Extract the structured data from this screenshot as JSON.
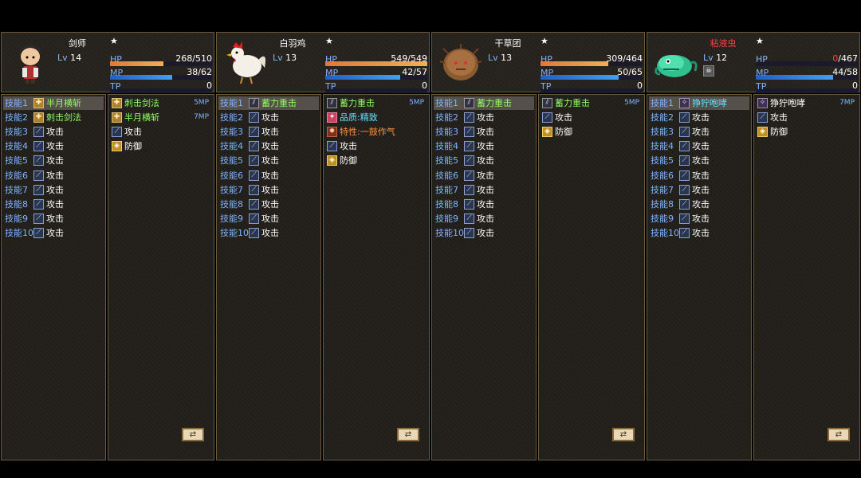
{
  "status_labels": {
    "hp": "HP",
    "mp": "MP",
    "tp": "TP"
  },
  "members": [
    {
      "name": "剑师",
      "name_color": "white",
      "level_label": "Lv",
      "level": "14",
      "star": "★",
      "hp_text": "268/510",
      "hp_ratio": 0.525,
      "mp_text": "38/62",
      "mp_ratio": 0.613,
      "tp_text": "0",
      "tp_ratio": 0,
      "slots": [
        {
          "label": "技能1",
          "skill": "半月横斩",
          "icon": "sword",
          "color": "green"
        },
        {
          "label": "技能2",
          "skill": "刺击剑法",
          "icon": "sword",
          "color": "green"
        },
        {
          "label": "技能3",
          "skill": "攻击",
          "icon": "attack",
          "color": "white"
        },
        {
          "label": "技能4",
          "skill": "攻击",
          "icon": "attack",
          "color": "white"
        },
        {
          "label": "技能5",
          "skill": "攻击",
          "icon": "attack",
          "color": "white"
        },
        {
          "label": "技能6",
          "skill": "攻击",
          "icon": "attack",
          "color": "white"
        },
        {
          "label": "技能7",
          "skill": "攻击",
          "icon": "attack",
          "color": "white"
        },
        {
          "label": "技能8",
          "skill": "攻击",
          "icon": "attack",
          "color": "white"
        },
        {
          "label": "技能9",
          "skill": "攻击",
          "icon": "attack",
          "color": "white"
        },
        {
          "label": "技能10",
          "skill": "攻击",
          "icon": "attack",
          "color": "white"
        }
      ],
      "skill_list": [
        {
          "name": "刺击剑法",
          "icon": "sword",
          "color": "green",
          "cost": "5MP"
        },
        {
          "name": "半月横斩",
          "icon": "sword",
          "color": "green",
          "cost": "7MP"
        },
        {
          "name": "攻击",
          "icon": "attack",
          "color": "white",
          "cost": ""
        },
        {
          "name": "防御",
          "icon": "defend",
          "color": "white",
          "cost": ""
        }
      ]
    },
    {
      "name": "白羽鸡",
      "name_color": "white",
      "level_label": "Lv",
      "level": "13",
      "star": "★",
      "hp_text": "549/549",
      "hp_ratio": 1.0,
      "mp_text": "42/57",
      "mp_ratio": 0.737,
      "tp_text": "0",
      "tp_ratio": 0,
      "slots": [
        {
          "label": "技能1",
          "skill": "蓄力重击",
          "icon": "charge",
          "color": "green"
        },
        {
          "label": "技能2",
          "skill": "攻击",
          "icon": "attack",
          "color": "white"
        },
        {
          "label": "技能3",
          "skill": "攻击",
          "icon": "attack",
          "color": "white"
        },
        {
          "label": "技能4",
          "skill": "攻击",
          "icon": "attack",
          "color": "white"
        },
        {
          "label": "技能5",
          "skill": "攻击",
          "icon": "attack",
          "color": "white"
        },
        {
          "label": "技能6",
          "skill": "攻击",
          "icon": "attack",
          "color": "white"
        },
        {
          "label": "技能7",
          "skill": "攻击",
          "icon": "attack",
          "color": "white"
        },
        {
          "label": "技能8",
          "skill": "攻击",
          "icon": "attack",
          "color": "white"
        },
        {
          "label": "技能9",
          "skill": "攻击",
          "icon": "attack",
          "color": "white"
        },
        {
          "label": "技能10",
          "skill": "攻击",
          "icon": "attack",
          "color": "white"
        }
      ],
      "skill_list": [
        {
          "name": "蓄力重击",
          "icon": "charge",
          "color": "green",
          "cost": "5MP"
        },
        {
          "name": "品质:精致",
          "icon": "quality",
          "color": "cyan",
          "cost": ""
        },
        {
          "name": "特性:一鼓作气",
          "icon": "trait",
          "color": "orange",
          "cost": ""
        },
        {
          "name": "攻击",
          "icon": "attack",
          "color": "white",
          "cost": ""
        },
        {
          "name": "防御",
          "icon": "defend",
          "color": "white",
          "cost": ""
        }
      ]
    },
    {
      "name": "干草团",
      "name_color": "white",
      "level_label": "Lv",
      "level": "13",
      "star": "★",
      "hp_text": "309/464",
      "hp_ratio": 0.666,
      "mp_text": "50/65",
      "mp_ratio": 0.769,
      "tp_text": "0",
      "tp_ratio": 0,
      "slots": [
        {
          "label": "技能1",
          "skill": "蓄力重击",
          "icon": "charge",
          "color": "green"
        },
        {
          "label": "技能2",
          "skill": "攻击",
          "icon": "attack",
          "color": "white"
        },
        {
          "label": "技能3",
          "skill": "攻击",
          "icon": "attack",
          "color": "white"
        },
        {
          "label": "技能4",
          "skill": "攻击",
          "icon": "attack",
          "color": "white"
        },
        {
          "label": "技能5",
          "skill": "攻击",
          "icon": "attack",
          "color": "white"
        },
        {
          "label": "技能6",
          "skill": "攻击",
          "icon": "attack",
          "color": "white"
        },
        {
          "label": "技能7",
          "skill": "攻击",
          "icon": "attack",
          "color": "white"
        },
        {
          "label": "技能8",
          "skill": "攻击",
          "icon": "attack",
          "color": "white"
        },
        {
          "label": "技能9",
          "skill": "攻击",
          "icon": "attack",
          "color": "white"
        },
        {
          "label": "技能10",
          "skill": "攻击",
          "icon": "attack",
          "color": "white"
        }
      ],
      "skill_list": [
        {
          "name": "蓄力重击",
          "icon": "charge",
          "color": "green",
          "cost": "5MP"
        },
        {
          "name": "攻击",
          "icon": "attack",
          "color": "white",
          "cost": ""
        },
        {
          "name": "防御",
          "icon": "defend",
          "color": "white",
          "cost": ""
        }
      ]
    },
    {
      "name": "粘液虫",
      "name_color": "red",
      "level_label": "Lv",
      "level": "12",
      "star": "★",
      "hp_text_red": "0",
      "hp_text_rest": "/467",
      "hp_ratio": 0,
      "mp_text": "44/58",
      "mp_ratio": 0.759,
      "tp_text": "0",
      "tp_ratio": 0,
      "status_icon": "skull-icon",
      "slots": [
        {
          "label": "技能1",
          "skill": "狰狞咆哮",
          "icon": "roar",
          "color": "cyan"
        },
        {
          "label": "技能2",
          "skill": "攻击",
          "icon": "attack",
          "color": "white"
        },
        {
          "label": "技能3",
          "skill": "攻击",
          "icon": "attack",
          "color": "white"
        },
        {
          "label": "技能4",
          "skill": "攻击",
          "icon": "attack",
          "color": "white"
        },
        {
          "label": "技能5",
          "skill": "攻击",
          "icon": "attack",
          "color": "white"
        },
        {
          "label": "技能6",
          "skill": "攻击",
          "icon": "attack",
          "color": "white"
        },
        {
          "label": "技能7",
          "skill": "攻击",
          "icon": "attack",
          "color": "white"
        },
        {
          "label": "技能8",
          "skill": "攻击",
          "icon": "attack",
          "color": "white"
        },
        {
          "label": "技能9",
          "skill": "攻击",
          "icon": "attack",
          "color": "white"
        },
        {
          "label": "技能10",
          "skill": "攻击",
          "icon": "attack",
          "color": "white"
        }
      ],
      "skill_list": [
        {
          "name": "狰狞咆哮",
          "icon": "roar",
          "color": "white",
          "cost": "7MP"
        },
        {
          "name": "攻击",
          "icon": "attack",
          "color": "white",
          "cost": ""
        },
        {
          "name": "防御",
          "icon": "defend",
          "color": "white",
          "cost": ""
        }
      ]
    }
  ],
  "colors": {
    "hp": "#e8903c",
    "mp": "#3a86e0",
    "tp": "#40c060",
    "label_blue": "#7fb4ff",
    "skill_green": "#90ff60",
    "danger_red": "#ff4040"
  },
  "icons": {
    "attack": "attack-icon",
    "sword": "sword-skill-icon",
    "charge": "charge-skill-icon",
    "defend": "shield-icon",
    "quality": "quality-icon",
    "trait": "trait-icon",
    "roar": "roar-skill-icon",
    "page": "page-switch-icon"
  }
}
